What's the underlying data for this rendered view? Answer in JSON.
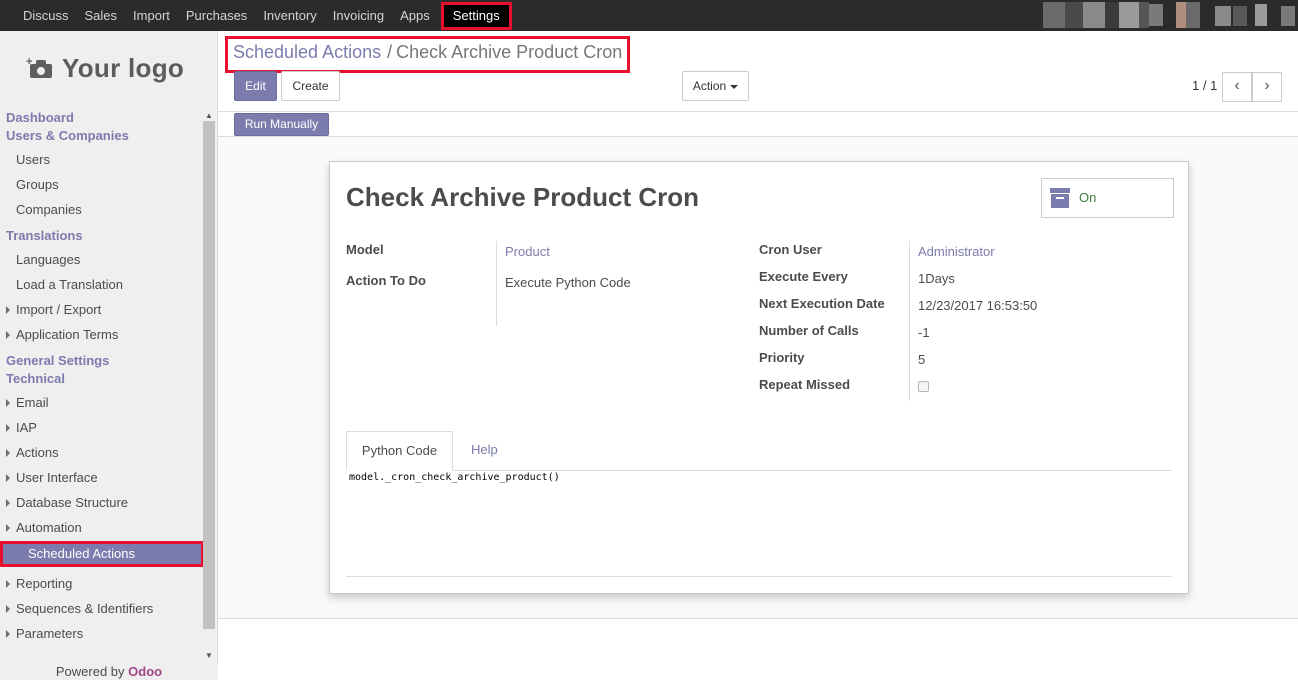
{
  "topmenu": {
    "items": [
      "Discuss",
      "Sales",
      "Import",
      "Purchases",
      "Inventory",
      "Invoicing",
      "Apps"
    ],
    "active": "Settings"
  },
  "sidebar": {
    "logo_text": "Your logo",
    "groups": [
      {
        "type": "head",
        "label": "Dashboard"
      },
      {
        "type": "head",
        "label": "Users & Companies"
      },
      {
        "type": "item",
        "label": "Users"
      },
      {
        "type": "item",
        "label": "Groups"
      },
      {
        "type": "item",
        "label": "Companies"
      },
      {
        "type": "head",
        "label": "Translations"
      },
      {
        "type": "item",
        "label": "Languages"
      },
      {
        "type": "item",
        "label": "Load a Translation"
      },
      {
        "type": "tree",
        "label": "Import / Export"
      },
      {
        "type": "tree",
        "label": "Application Terms"
      },
      {
        "type": "head",
        "label": "General Settings"
      },
      {
        "type": "head",
        "label": "Technical"
      },
      {
        "type": "tree",
        "label": "Email"
      },
      {
        "type": "tree",
        "label": "IAP"
      },
      {
        "type": "tree",
        "label": "Actions"
      },
      {
        "type": "tree",
        "label": "User Interface"
      },
      {
        "type": "tree",
        "label": "Database Structure"
      },
      {
        "type": "tree",
        "label": "Automation"
      },
      {
        "type": "selected",
        "label": "Scheduled Actions"
      },
      {
        "type": "tree",
        "label": "Reporting"
      },
      {
        "type": "tree",
        "label": "Sequences & Identifiers"
      },
      {
        "type": "tree",
        "label": "Parameters"
      }
    ],
    "powered_prefix": "Powered by",
    "powered_brand": "Odoo"
  },
  "control_panel": {
    "breadcrumb_parent": "Scheduled Actions",
    "breadcrumb_sep": "/",
    "breadcrumb_current": "Check Archive Product Cron",
    "edit_label": "Edit",
    "create_label": "Create",
    "action_label": "Action",
    "pager": "1 / 1",
    "prev_icon": "‹",
    "next_icon": "›",
    "run_manually_label": "Run Manually"
  },
  "record": {
    "title": "Check Archive Product Cron",
    "active_label": "On",
    "left_fields": [
      {
        "label": "Model",
        "value": "Product",
        "link": true
      },
      {
        "label": "Action To Do",
        "value": "Execute Python Code",
        "link": false
      }
    ],
    "right_fields": [
      {
        "label": "Cron User",
        "value": "Administrator",
        "link": true
      },
      {
        "label": "Execute Every",
        "value": "1Days",
        "link": false
      },
      {
        "label": "Next Execution Date",
        "value": "12/23/2017 16:53:50",
        "link": false
      },
      {
        "label": "Number of Calls",
        "value": "-1",
        "link": false
      },
      {
        "label": "Priority",
        "value": "5",
        "link": false
      },
      {
        "label": "Repeat Missed",
        "value": "",
        "checkbox": true
      }
    ],
    "tabs": [
      "Python Code",
      "Help"
    ],
    "code": "model._cron_check_archive_product()"
  },
  "colors": {
    "accent": "#7c7bad",
    "highlight": "#e8112d",
    "navbar": "#2b2b2b"
  }
}
